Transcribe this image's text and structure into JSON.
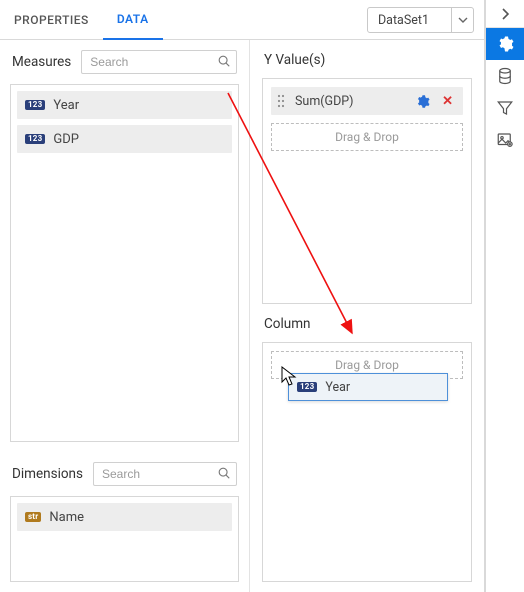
{
  "tabs": {
    "properties": "PROPERTIES",
    "data": "DATA"
  },
  "dataset": {
    "selected": "DataSet1"
  },
  "left": {
    "measures": {
      "title": "Measures",
      "search_placeholder": "Search",
      "items": [
        {
          "type": "num",
          "label": "Year"
        },
        {
          "type": "num",
          "label": "GDP"
        }
      ]
    },
    "dimensions": {
      "title": "Dimensions",
      "search_placeholder": "Search",
      "items": [
        {
          "type": "str",
          "label": "Name"
        }
      ]
    }
  },
  "right": {
    "yvalues": {
      "title": "Y Value(s)",
      "items": [
        {
          "label": "Sum(GDP)"
        }
      ],
      "drop_hint": "Drag & Drop"
    },
    "column": {
      "title": "Column",
      "drop_hint": "Drag & Drop"
    }
  },
  "drag_ghost": {
    "type": "num",
    "label": "Year"
  },
  "badges": {
    "num": "123",
    "str": "str"
  }
}
